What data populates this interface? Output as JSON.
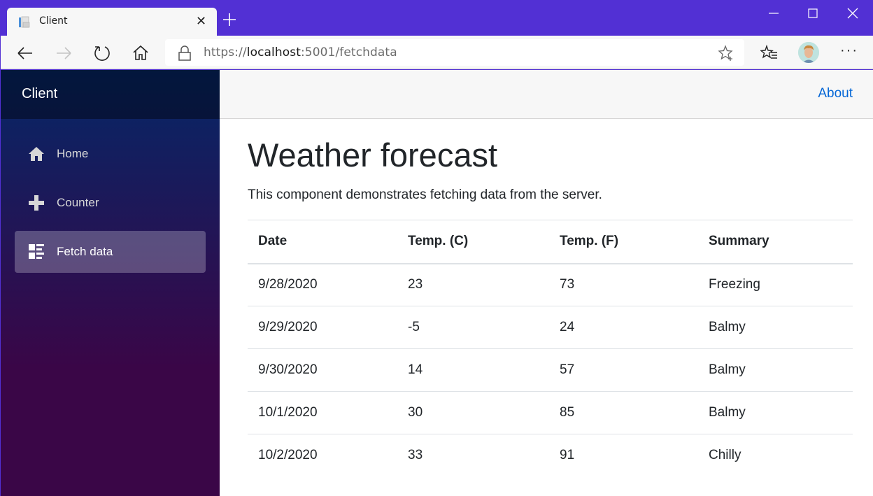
{
  "browser": {
    "tab_title": "Client",
    "url_scheme": "https://",
    "url_host": "localhost",
    "url_rest": ":5001/fetchdata",
    "icons": [
      "back-icon",
      "forward-icon",
      "refresh-icon",
      "home-icon",
      "lock-icon",
      "add-favorite-icon",
      "favorites-icon",
      "profile-avatar",
      "more-icon"
    ],
    "accent_color": "#5230d4"
  },
  "app": {
    "brand": "Client",
    "about_label": "About",
    "nav": [
      {
        "label": "Home",
        "icon": "home-icon"
      },
      {
        "label": "Counter",
        "icon": "plus-icon"
      },
      {
        "label": "Fetch data",
        "icon": "list-rich-icon",
        "active": true
      }
    ]
  },
  "main": {
    "title": "Weather forecast",
    "description": "This component demonstrates fetching data from the server.",
    "table": {
      "headers": [
        "Date",
        "Temp. (C)",
        "Temp. (F)",
        "Summary"
      ],
      "rows": [
        [
          "9/28/2020",
          "23",
          "73",
          "Freezing"
        ],
        [
          "9/29/2020",
          "-5",
          "24",
          "Balmy"
        ],
        [
          "9/30/2020",
          "14",
          "57",
          "Balmy"
        ],
        [
          "10/1/2020",
          "30",
          "85",
          "Balmy"
        ],
        [
          "10/2/2020",
          "33",
          "91",
          "Chilly"
        ]
      ]
    }
  }
}
